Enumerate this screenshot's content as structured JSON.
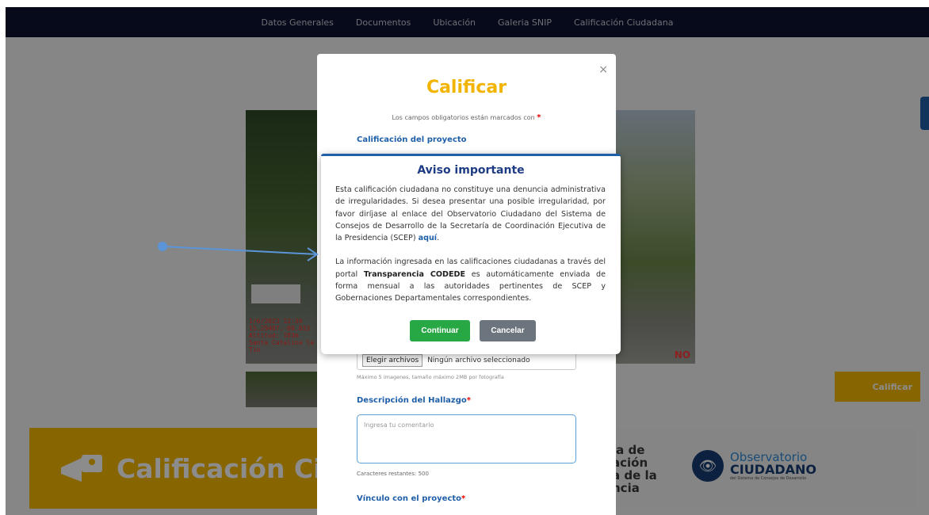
{
  "nav": {
    "items": [
      "Datos Generales",
      "Documentos",
      "Ubicación",
      "Galeria SNIP",
      "Calificación Ciudadana"
    ]
  },
  "photo_overlay": {
    "text_lines": [
      "1/6/2023 12:34",
      "15.29407,-89.833",
      "Altitud: 183m",
      "Santa Catalina la Tin"
    ],
    "no_label": "NO"
  },
  "banner": {
    "title": "Calificación Ci",
    "mid_text": "ia de\nación\na de la\nncia",
    "obs_line1": "Observatorio",
    "obs_line2": "CIUDADANO",
    "obs_line3": "del Sistema de Consejos de Desarrollo"
  },
  "side_button": {
    "label": "Calificar"
  },
  "rate_modal": {
    "close": "×",
    "title": "Calificar",
    "required_note": "Los campos obligatorios están marcados con",
    "required_mark": "*",
    "section_project": "Calificación del proyecto",
    "file_button": "Elegir archivos",
    "file_status": "Ningún archivo seleccionado",
    "file_hint": "Máximo 5 imagenes, tamaño máximo 2MB por fotografía",
    "section_hallazgo": "Descripción del Hallazgo",
    "textarea_placeholder": "Ingresa tu comentario",
    "chars_left": "Caracteres restantes: 500",
    "section_vinculo": "Vínculo con el proyecto"
  },
  "notice": {
    "title": "Aviso importante",
    "p1": "Esta calificación ciudadana no constituye una denuncia administrativa de irregularidades. Si desea presentar una posible irregularidad, por favor diríjase al enlace del Observatorio Ciudadano del Sistema de Consejos de Desarrollo de la Secretaría de Coordinación Ejecutiva de la Presidencia (SCEP)",
    "p1_link": "aquí",
    "p2_a": "La información ingresada en las calificaciones ciudadanas a través del portal",
    "p2_bold": "Transparencia CODEDE",
    "p2_b": "es automáticamente enviada de forma mensual a las autoridades pertinentes de SCEP y Gobernaciones Departamentales correspondientes.",
    "continue_label": "Continuar",
    "cancel_label": "Cancelar"
  },
  "colors": {
    "accent_yellow": "#f6b800",
    "title_blue": "#1e3c84",
    "continue_green": "#28a745",
    "cancel_gray": "#6c757d",
    "annotation_blue": "#5b95d8"
  }
}
